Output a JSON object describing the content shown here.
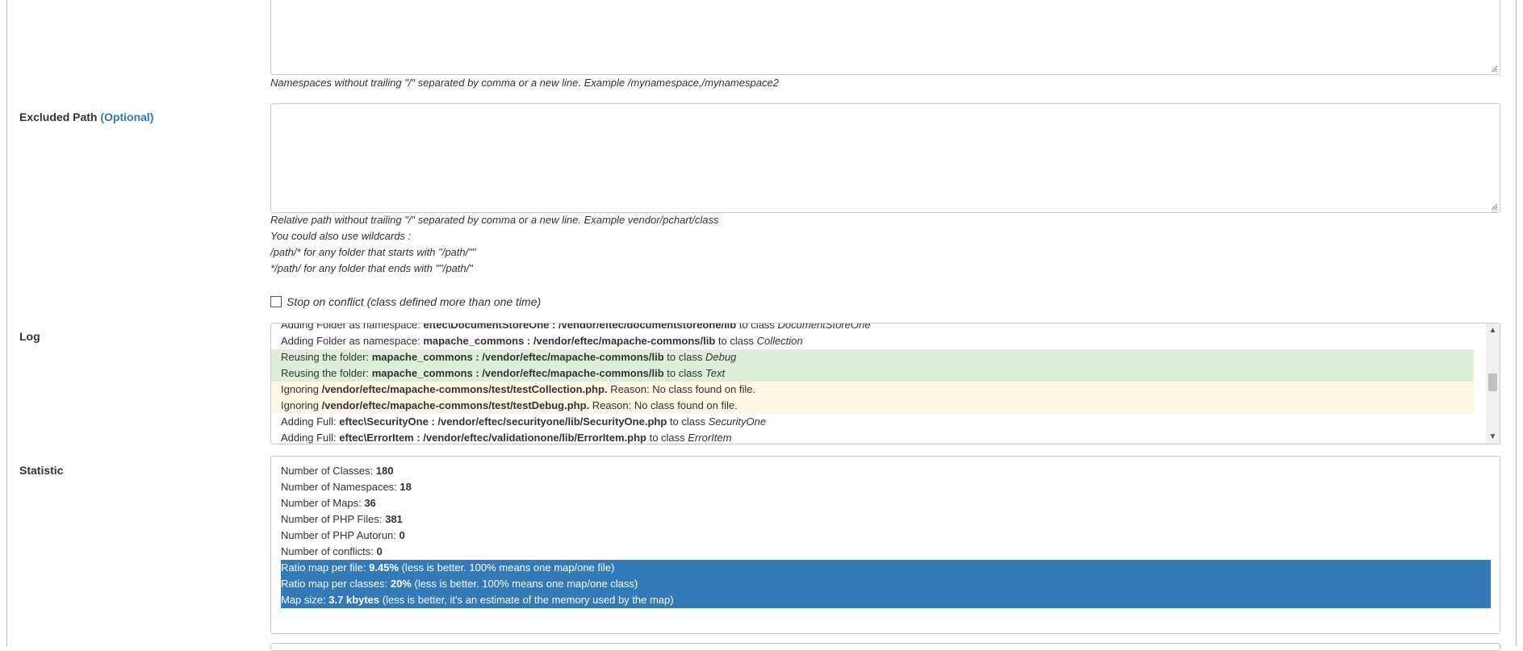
{
  "namespaces": {
    "help": "Namespaces without trailing \"/\" separated by comma or a new line. Example /mynamespace,/mynamespace2"
  },
  "excluded_path": {
    "label": "Excluded Path",
    "optional": "(Optional)",
    "help_lines": [
      "Relative path without trailing \"/\" separated by comma or a new line. Example vendor/pchart/class",
      "You could also use wildcards :",
      "/path/* for any folder that starts with \"/path/\"\"",
      "*/path/ for any folder that ends with \"\"/path/\""
    ]
  },
  "stop_on_conflict": {
    "label": "Stop on conflict (class defined more than one time)"
  },
  "log": {
    "label": "Log",
    "lines": [
      {
        "type": "normal",
        "prefix": "Adding Folder as namespace: ",
        "bold": "eftec\\DocumentStoreOne : /vendor/eftec/documentstoreone/lib",
        "mid": " to class ",
        "italic": "DocumentStoreOne"
      },
      {
        "type": "normal",
        "prefix": "Adding Folder as namespace: ",
        "bold": "mapache_commons : /vendor/eftec/mapache-commons/lib",
        "mid": " to class ",
        "italic": "Collection"
      },
      {
        "type": "green",
        "prefix": "Reusing the folder: ",
        "bold": "mapache_commons : /vendor/eftec/mapache-commons/lib",
        "mid": " to class ",
        "italic": "Debug"
      },
      {
        "type": "green",
        "prefix": "Reusing the folder: ",
        "bold": "mapache_commons : /vendor/eftec/mapache-commons/lib",
        "mid": " to class ",
        "italic": "Text"
      },
      {
        "type": "yellow",
        "prefix": "Ignoring ",
        "bold": "/vendor/eftec/mapache-commons/test/testCollection.php.",
        "mid": " Reason: No class found on file.",
        "italic": ""
      },
      {
        "type": "yellow",
        "prefix": "Ignoring ",
        "bold": "/vendor/eftec/mapache-commons/test/testDebug.php.",
        "mid": " Reason: No class found on file.",
        "italic": ""
      },
      {
        "type": "normal",
        "prefix": "Adding Full: ",
        "bold": "eftec\\SecurityOne : /vendor/eftec/securityone/lib/SecurityOne.php",
        "mid": " to class ",
        "italic": "SecurityOne"
      },
      {
        "type": "normal",
        "prefix": "Adding Full: ",
        "bold": "eftec\\ErrorItem : /vendor/eftec/validationone/lib/ErrorItem.php",
        "mid": " to class ",
        "italic": "ErrorItem"
      }
    ]
  },
  "statistic": {
    "label": "Statistic",
    "lines": [
      {
        "hl": false,
        "prefix": "Number of Classes: ",
        "bold": "180",
        "suffix": ""
      },
      {
        "hl": false,
        "prefix": "Number of Namespaces: ",
        "bold": "18",
        "suffix": ""
      },
      {
        "hl": false,
        "prefix": "Number of Maps: ",
        "bold": "36",
        "suffix": ""
      },
      {
        "hl": false,
        "prefix": "Number of PHP Files: ",
        "bold": "381",
        "suffix": ""
      },
      {
        "hl": false,
        "prefix": "Number of PHP Autorun: ",
        "bold": "0",
        "suffix": ""
      },
      {
        "hl": false,
        "prefix": "Number of conflicts: ",
        "bold": "0",
        "suffix": ""
      },
      {
        "hl": true,
        "prefix": "Ratio map per file: ",
        "bold": "9.45%",
        "suffix": " (less is better. 100% means one map/one file)"
      },
      {
        "hl": true,
        "prefix": "Ratio map per classes: ",
        "bold": "20%",
        "suffix": " (less is better. 100% means one map/one class)"
      },
      {
        "hl": true,
        "prefix": "Map size: ",
        "bold": "3.7 kbytes",
        "suffix": " (less is better, it's an estimate of the memory used by the map)"
      }
    ]
  }
}
